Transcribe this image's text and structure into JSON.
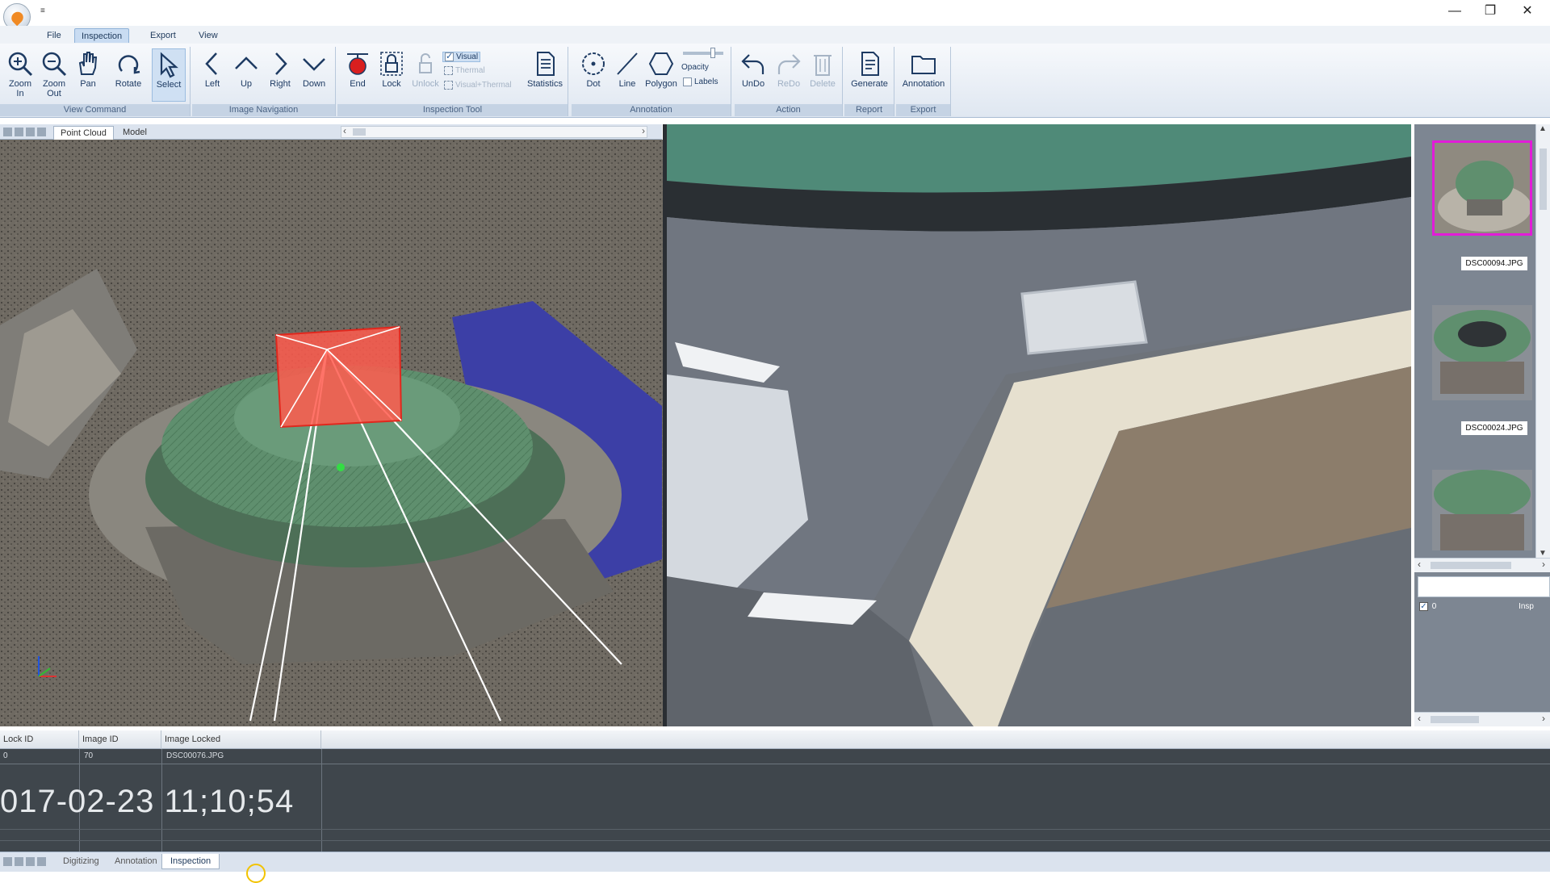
{
  "window": {
    "quick_access": "≡",
    "minimize": "—",
    "restore": "❐",
    "close": "✕"
  },
  "menu": {
    "items": [
      "File",
      "Inspection",
      "Export",
      "View"
    ],
    "active": "Inspection"
  },
  "ribbon": {
    "groups": {
      "view_command": "View Command",
      "image_navigation": "Image Navigation",
      "inspection_tool": "Inspection Tool",
      "annotation": "Annotation",
      "action": "Action",
      "report": "Report",
      "export": "Export"
    },
    "tools": {
      "zoom_in": "Zoom\nIn",
      "zoom_out": "Zoom\nOut",
      "pan": "Pan",
      "rotate": "Rotate",
      "select": "Select",
      "left": "Left",
      "up": "Up",
      "right": "Right",
      "down": "Down",
      "end": "End",
      "lock": "Lock",
      "unlock": "Unlock",
      "statistics": "Statistics",
      "dot": "Dot",
      "line": "Line",
      "polygon": "Polygon",
      "opacity": "Opacity",
      "labels": "Labels",
      "undo": "UnDo",
      "redo": "ReDo",
      "delete": "Delete",
      "generate": "Generate",
      "annotation": "Annotation"
    },
    "checks": {
      "visual": "Visual",
      "thermal": "Thermal",
      "visual_thermal": "Visual+Thermal"
    }
  },
  "doc_tabs": [
    "Point Cloud",
    "Model"
  ],
  "thumbnails": [
    {
      "label": "DSC00094.JPG",
      "active": true
    },
    {
      "label": "DSC00024.JPG",
      "active": false
    }
  ],
  "side_panel": {
    "check_label": "0",
    "insp_label": "Insp"
  },
  "grid": {
    "columns": [
      "Lock ID",
      "Image ID",
      "Image Locked"
    ],
    "rows": [
      [
        "0",
        "70",
        "DSC00076.JPG"
      ]
    ],
    "timestamp": "017-02-23 11;10;54"
  },
  "bottom_tabs": [
    "Digitizing",
    "Annotation",
    "Inspection"
  ],
  "active_bottom_tab": "Inspection",
  "colors": {
    "ribbon_label": "#c5d3e4",
    "selection_frame": "#e21cd8",
    "camera_frustum": "#ff4a3d",
    "dome": "#5f8f6e"
  }
}
